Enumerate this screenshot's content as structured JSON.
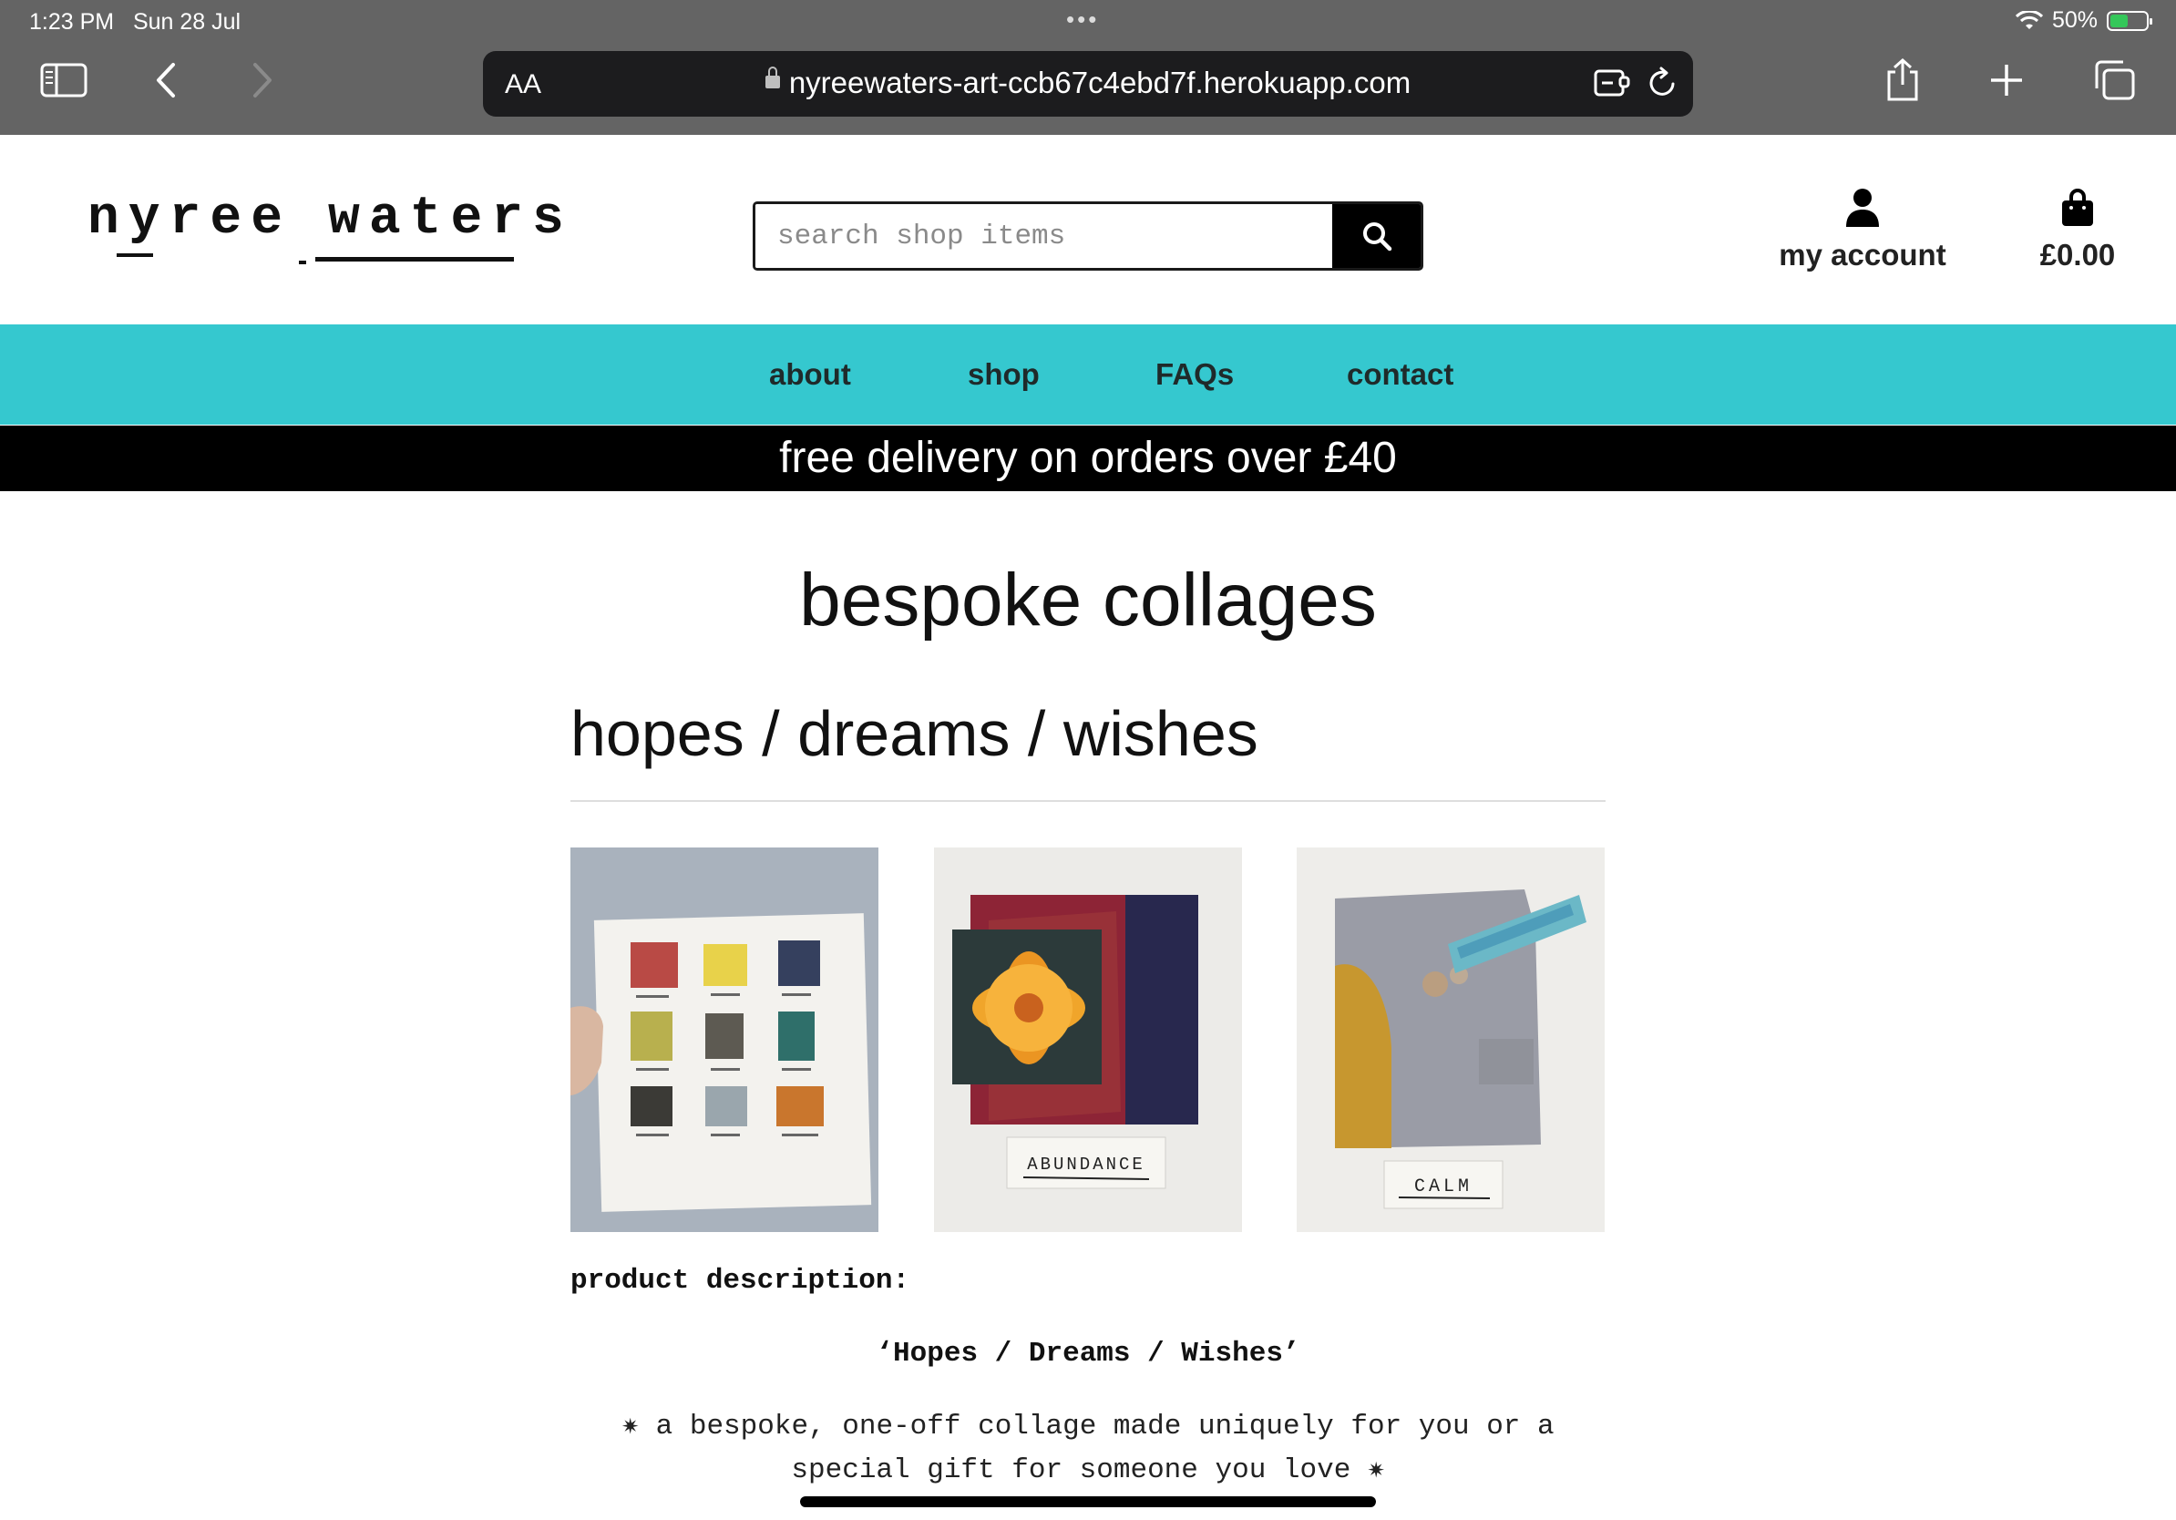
{
  "status_bar": {
    "time": "1:23 PM",
    "date": "Sun 28 Jul",
    "battery": "50%",
    "battery_level": 0.5
  },
  "browser": {
    "text_size_label": "AA",
    "url": "nyreewaters-art-ccb67c4ebd7f.herokuapp.com"
  },
  "header": {
    "logo_word1": "nyree",
    "logo_word2": "waters",
    "search_placeholder": "search shop items",
    "account_label": "my account",
    "cart_total": "£0.00"
  },
  "nav": {
    "items": [
      "about",
      "shop",
      "FAQs",
      "contact"
    ]
  },
  "promo": "free delivery on orders over £40",
  "page": {
    "title": "bespoke collages",
    "product_title": "hopes / dreams / wishes",
    "images": [
      {
        "alt": "grid of nine mini collages",
        "label": ""
      },
      {
        "alt": "abundance collage",
        "label": "ABUNDANCE"
      },
      {
        "alt": "calm collage",
        "label": "CALM"
      }
    ],
    "description_label": "product description:",
    "quote": "‘Hopes / Dreams / Wishes’",
    "description": "✷ a bespoke, one-off collage made uniquely for you or a special gift for someone you love ✷"
  },
  "colors": {
    "nav_bg": "#35c8cf",
    "chrome_bg": "#646464",
    "promo_bg": "#000000"
  }
}
